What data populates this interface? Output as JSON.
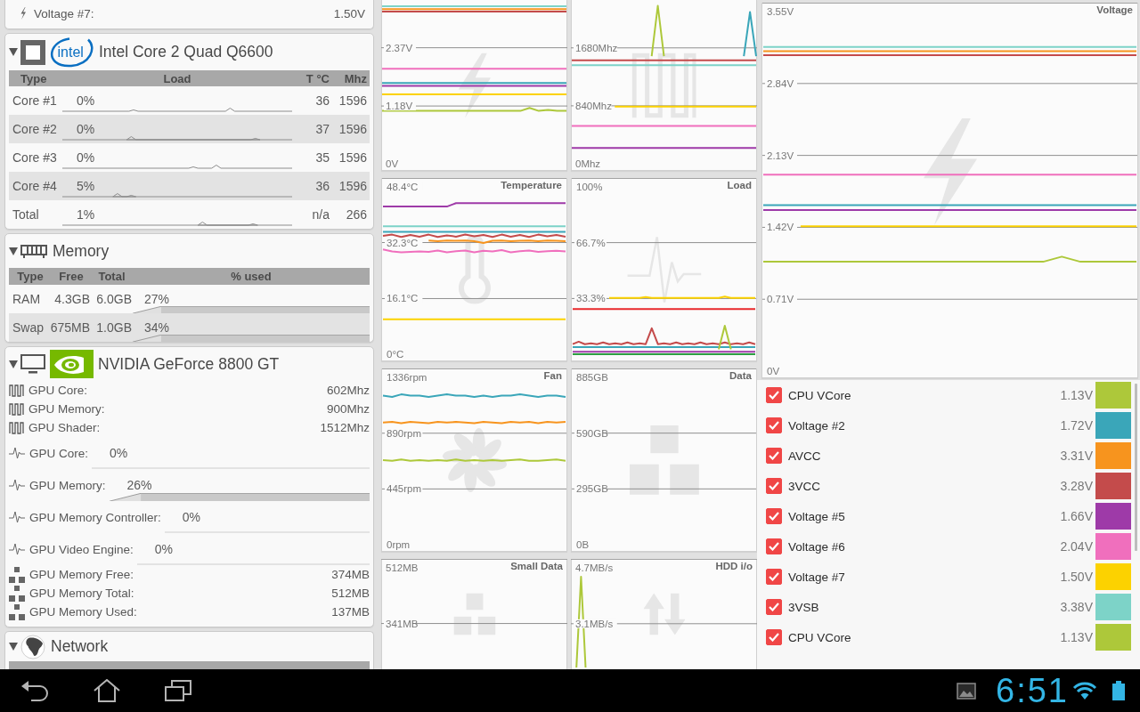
{
  "voltage_panel": {
    "rows": [
      {
        "kind": "voltage",
        "label": "Voltage #7:",
        "value": "1.50V"
      }
    ]
  },
  "cpu": {
    "expanded": true,
    "logo_text": "intel",
    "title": "Intel Core 2 Quad Q6600",
    "columns": [
      "Type",
      "Load",
      "T °C",
      "Mhz"
    ],
    "rows": [
      {
        "name": "Core #1",
        "load": "0%",
        "temperature": "36",
        "clock": "1596"
      },
      {
        "name": "Core #2",
        "load": "0%",
        "temperature": "37",
        "clock": "1596"
      },
      {
        "name": "Core #3",
        "load": "0%",
        "temperature": "35",
        "clock": "1596"
      },
      {
        "name": "Core #4",
        "load": "5%",
        "temperature": "36",
        "clock": "1596"
      },
      {
        "name": "Total",
        "load": "1%",
        "temperature": "n/a",
        "clock": "266"
      }
    ]
  },
  "memory": {
    "expanded": true,
    "title": "Memory",
    "columns": [
      "Type",
      "Free",
      "Total",
      "% used"
    ],
    "rows": [
      {
        "type": "RAM",
        "free": "4.3GB",
        "total": "6.0GB",
        "used": "27%"
      },
      {
        "type": "Swap",
        "free": "675MB",
        "total": "1.0GB",
        "used": "34%"
      }
    ]
  },
  "gpu": {
    "expanded": true,
    "title": "NVIDIA GeForce 8800 GT",
    "rows": [
      {
        "kind": "clock",
        "label": "GPU Core:",
        "value": "602Mhz"
      },
      {
        "kind": "clock",
        "label": "GPU Memory:",
        "value": "900Mhz"
      },
      {
        "kind": "clock",
        "label": "GPU Shader:",
        "value": "1512Mhz"
      },
      {
        "kind": "load",
        "label": "GPU Core:",
        "value": "0%"
      },
      {
        "kind": "load_area",
        "label": "GPU Memory:",
        "value": "26%"
      },
      {
        "kind": "load",
        "label": "GPU Memory Controller:",
        "value": "0%"
      },
      {
        "kind": "load",
        "label": "GPU Video Engine:",
        "value": "0%"
      },
      {
        "kind": "memory",
        "label": "GPU Memory Free:",
        "value": "374MB"
      },
      {
        "kind": "memory",
        "label": "GPU Memory Total:",
        "value": "512MB"
      },
      {
        "kind": "memory",
        "label": "GPU Memory Used:",
        "value": "137MB"
      }
    ]
  },
  "network": {
    "expanded": true,
    "title": "Network"
  },
  "charts": [
    {
      "kind": "voltage",
      "chart_data": {
        "type": "line",
        "grid": true,
        "categories": [
          null,
          null,
          null,
          null,
          null,
          null,
          null,
          null,
          null,
          null,
          null,
          null,
          null,
          null,
          null,
          null,
          null,
          null,
          null,
          null,
          null
        ],
        "ylim": [
          -0.145,
          3.345
        ],
        "yticks": [
          {
            "value": 0,
            "label": "0V"
          },
          {
            "value": 1.18,
            "label": "1.18V"
          },
          {
            "value": 2.37,
            "label": "2.37V"
          }
        ],
        "series": [
          {
            "color": "#7dd3c8",
            "values": [
              3.22,
              3.22,
              3.22,
              3.22,
              3.22,
              3.22,
              3.22,
              3.22,
              3.22,
              3.22,
              3.22,
              3.22,
              3.22,
              3.22,
              3.22,
              3.22,
              3.22,
              3.22,
              3.22,
              3.22,
              3.22
            ]
          },
          {
            "color": "#f7941e",
            "values": [
              3.16,
              3.16,
              3.16,
              3.16,
              3.16,
              3.16,
              3.16,
              3.16,
              3.16,
              3.16,
              3.16,
              3.16,
              3.16,
              3.16,
              3.16,
              3.16,
              3.16,
              3.16,
              3.16,
              3.16,
              3.16
            ]
          },
          {
            "color": "#c44b4b",
            "values": [
              3.11,
              3.11,
              3.11,
              3.11,
              3.11,
              3.11,
              3.11,
              3.11,
              3.11,
              3.11,
              3.11,
              3.11,
              3.11,
              3.11,
              3.11,
              3.11,
              3.11,
              3.11,
              3.11,
              3.11,
              3.11
            ]
          },
          {
            "color": "#f06fbd",
            "values": [
              1.94,
              1.94,
              1.94,
              1.94,
              1.94,
              1.94,
              1.94,
              1.94,
              1.94,
              1.94,
              1.94,
              1.94,
              1.94,
              1.94,
              1.94,
              1.94,
              1.94,
              1.94,
              1.94,
              1.94,
              1.94
            ]
          },
          {
            "color": "#3aa6b9",
            "values": [
              1.65,
              1.65,
              1.65,
              1.65,
              1.65,
              1.65,
              1.65,
              1.65,
              1.65,
              1.65,
              1.65,
              1.65,
              1.65,
              1.65,
              1.65,
              1.65,
              1.65,
              1.65,
              1.65,
              1.65,
              1.65
            ]
          },
          {
            "color": "#9e3aa8",
            "values": [
              1.59,
              1.59,
              1.59,
              1.59,
              1.59,
              1.59,
              1.59,
              1.59,
              1.59,
              1.59,
              1.59,
              1.59,
              1.59,
              1.59,
              1.59,
              1.59,
              1.59,
              1.59,
              1.59,
              1.59,
              1.59
            ]
          },
          {
            "color": "#fcd200",
            "values": [
              1.42,
              1.42,
              1.42,
              1.42,
              1.42,
              1.42,
              1.42,
              1.42,
              1.42,
              1.42,
              1.42,
              1.42,
              1.42,
              1.42,
              1.42,
              1.42,
              1.42,
              1.42,
              1.42,
              1.42,
              1.42
            ]
          },
          {
            "color": "#adc83a",
            "values": [
              1.08,
              1.08,
              1.08,
              1.08,
              1.08,
              1.08,
              1.08,
              1.08,
              1.08,
              1.08,
              1.08,
              1.08,
              1.08,
              1.08,
              1.08,
              1.08,
              1.14,
              1.08,
              1.1,
              1.08,
              1.08
            ]
          }
        ]
      }
    },
    {
      "kind": "clock",
      "chart_data": {
        "type": "line",
        "grid": true,
        "categories": [
          null,
          null,
          null,
          null,
          null,
          null,
          null,
          null,
          null,
          null,
          null,
          null,
          null,
          null,
          null,
          null,
          null,
          null,
          null,
          null,
          null,
          null,
          null,
          null,
          null,
          null,
          null,
          null,
          null,
          null,
          null
        ],
        "ylim": [
          -103,
          2374
        ],
        "yticks": [
          {
            "value": 0,
            "label": "0Mhz"
          },
          {
            "value": 840,
            "label": "840Mhz"
          },
          {
            "value": 1680,
            "label": "1680Mhz"
          }
        ],
        "series": [
          {
            "color": "#7dd3c8",
            "values": [
              1430,
              1430,
              1430,
              1430,
              1430,
              1430,
              1430,
              1430,
              1430,
              1430,
              1430,
              1430,
              1430,
              1430,
              1430,
              1430,
              1430,
              1430,
              1430,
              1430,
              1430,
              1430,
              1430,
              1430,
              1430,
              1430,
              1430,
              1430,
              1430,
              1430,
              1430
            ]
          },
          {
            "color": "#c44b4b",
            "values": [
              1500,
              1500,
              1500,
              1500,
              1500,
              1500,
              1500,
              1500,
              1500,
              1500,
              1500,
              1500,
              1500,
              1500,
              1500,
              1500,
              1500,
              1500,
              1500,
              1500,
              1500,
              1500,
              1500,
              1500,
              1500,
              1500,
              1500,
              1500,
              1500,
              1500,
              1500
            ]
          },
          {
            "color": "#adc83a",
            "values": [
              null,
              null,
              null,
              null,
              null,
              null,
              null,
              null,
              null,
              null,
              null,
              null,
              null,
              1560,
              2290,
              1560,
              null,
              null,
              null,
              null,
              null,
              null,
              null,
              null,
              null,
              null,
              null,
              null,
              null,
              null,
              null
            ]
          },
          {
            "color": "#3aa6b9",
            "values": [
              null,
              null,
              null,
              null,
              null,
              null,
              null,
              null,
              null,
              null,
              null,
              null,
              null,
              null,
              null,
              null,
              null,
              null,
              null,
              null,
              null,
              null,
              null,
              null,
              null,
              null,
              null,
              null,
              1560,
              2200,
              1560
            ]
          },
          {
            "color": "#fcd200",
            "values": [
              null,
              null,
              null,
              null,
              null,
              null,
              null,
              830,
              830,
              830,
              830,
              830,
              830,
              830,
              830,
              830,
              830,
              830,
              830,
              830,
              830,
              830,
              830,
              830,
              830,
              830,
              830,
              830,
              830,
              830,
              830
            ]
          },
          {
            "color": "#f06fbd",
            "values": [
              550,
              550,
              550,
              550,
              550,
              550,
              550,
              550,
              550,
              550,
              550,
              550,
              550,
              550,
              550,
              550,
              550,
              550,
              550,
              550,
              550,
              550,
              550,
              550,
              550,
              550,
              550,
              550,
              550,
              550,
              550
            ]
          },
          {
            "color": "#9e3aa8",
            "values": [
              230,
              230,
              230,
              230,
              230,
              230,
              230,
              230,
              230,
              230,
              230,
              230,
              230,
              230,
              230,
              230,
              230,
              230,
              230,
              230,
              230,
              230,
              230,
              230,
              230,
              230,
              230,
              230,
              230,
              230,
              230
            ]
          }
        ]
      }
    },
    {
      "kind": "temperature",
      "chart_data": {
        "type": "line",
        "grid": true,
        "title": "Temperature",
        "categories": [
          null,
          null,
          null,
          null,
          null,
          null,
          null,
          null,
          null,
          null,
          null,
          null,
          null,
          null,
          null,
          null,
          null,
          null,
          null,
          null,
          null
        ],
        "ylim": [
          -2.06,
          50.97
        ],
        "yticks": [
          {
            "value": 0,
            "label": "0°C"
          },
          {
            "value": 16.1,
            "label": "16.1°C"
          },
          {
            "value": 32.3,
            "label": "32.3°C"
          },
          {
            "value": 48.4,
            "label": "48.4°C"
          }
        ],
        "series": [
          {
            "color": "#9e3aa8",
            "values": [
              42.7,
              42.7,
              42.7,
              42.7,
              42.7,
              42.7,
              42.7,
              42.7,
              43.7,
              43.7,
              43.7,
              43.7,
              43.7,
              43.7,
              43.7,
              43.7,
              43.7,
              43.7,
              43.7,
              43.7,
              43.7
            ]
          },
          {
            "color": "#7dd3c8",
            "values": [
              37,
              37,
              37,
              37,
              37,
              37,
              37,
              37,
              37,
              37,
              37,
              37,
              37,
              37,
              37,
              37,
              37,
              37,
              37,
              37,
              37
            ]
          },
          {
            "color": "#3aa6b9",
            "values": [
              35.4,
              35.4,
              35.4,
              35.4,
              35.4,
              35.4,
              35.4,
              35.4,
              35.4,
              35.4,
              35.4,
              35.4,
              35.4,
              35.4,
              35.4,
              35.4,
              35.4,
              35.4,
              35.4,
              35.4,
              35.4
            ]
          },
          {
            "color": "#c44b4b",
            "values": [
              34.2,
              34.6,
              33.9,
              34.5,
              34,
              34.6,
              33.9,
              34.4,
              34,
              34.6,
              34.1,
              34.5,
              33.9,
              34.6,
              34,
              34.5,
              33.9,
              34.6,
              34.1,
              34.5,
              34
            ]
          },
          {
            "color": "#f7941e",
            "values": [
              null,
              null,
              null,
              null,
              null,
              32.9,
              32.7,
              32.9,
              32.8,
              32.9,
              32.7,
              32.2,
              32.8,
              32.9,
              32.7,
              32.8,
              32.9,
              32.7,
              32.9,
              32.8,
              32.7
            ]
          },
          {
            "color": "#f06fbd",
            "values": [
              30.3,
              29.7,
              29.5,
              29.6,
              29.7,
              29.6,
              30,
              29.5,
              29.8,
              30,
              29.5,
              29.9,
              29.7,
              30.1,
              29.5,
              29.8,
              30,
              29.6,
              29.8,
              29.9,
              29.7
            ]
          },
          {
            "color": "#fcd200",
            "values": [
              10.1,
              10.1,
              10.1,
              10.1,
              10.1,
              10.1,
              10.1,
              10.1,
              10.1,
              10.1,
              10.1,
              10.1,
              10.1,
              10.1,
              10.1,
              10.1,
              10.1,
              10.1,
              10.1,
              10.1,
              10.1
            ]
          }
        ]
      }
    },
    {
      "kind": "load",
      "chart_data": {
        "type": "line",
        "grid": true,
        "title": "Load",
        "categories": [
          null,
          null,
          null,
          null,
          null,
          null,
          null,
          null,
          null,
          null,
          null,
          null,
          null,
          null,
          null,
          null,
          null,
          null,
          null,
          null,
          null,
          null,
          null,
          null,
          null,
          null,
          null,
          null,
          null,
          null,
          null
        ],
        "ylim": [
          -4.26,
          105.32
        ],
        "yticks": [
          {
            "value": 33.3,
            "label": "33.3%"
          },
          {
            "value": 66.7,
            "label": "66.7%"
          },
          {
            "value": 100,
            "label": "100%"
          }
        ],
        "series": [
          {
            "color": "#fcd200",
            "values": [
              null,
              null,
              null,
              null,
              null,
              null,
              33.6,
              33.6,
              33.6,
              33.6,
              33.6,
              33.6,
              34.2,
              33.6,
              33.6,
              33.6,
              33.6,
              33.6,
              33.6,
              33.6,
              33.6,
              33.6,
              33.6,
              33.6,
              33.6,
              34.4,
              33.6,
              33.6,
              33.6,
              33.6,
              33.6
            ]
          },
          {
            "color": "#e8282b",
            "values": [
              27,
              27,
              27,
              27,
              27,
              27,
              27,
              27,
              27,
              27,
              27,
              27,
              27,
              27,
              27,
              27,
              27,
              27,
              27,
              27,
              27,
              27,
              27,
              27,
              27,
              27,
              27,
              27,
              27,
              27,
              27
            ]
          },
          {
            "color": "#c44b4b",
            "values": [
              6,
              7.5,
              6,
              6.5,
              6,
              7,
              6,
              6.5,
              6,
              7,
              6,
              6.5,
              6,
              15.5,
              6,
              6.5,
              6,
              7,
              6,
              6.5,
              6,
              7,
              6,
              6.5,
              6,
              7,
              6,
              6.5,
              6,
              7,
              6
            ]
          },
          {
            "color": "#3aa6b9",
            "values": [
              4.2,
              4.2,
              4.2,
              4.2,
              4.2,
              4.2,
              4.2,
              4.2,
              4.2,
              4.2,
              4.2,
              4.2,
              4.2,
              4.2,
              4.2,
              4.2,
              4.2,
              4.2,
              4.2,
              4.2,
              4.2,
              4.2,
              4.2,
              4.2,
              4.2,
              4.2,
              4.2,
              4.2,
              4.2,
              4.2,
              4.2
            ]
          },
          {
            "color": "#9e3aa8",
            "values": [
              1.5,
              1.5,
              1.5,
              1.5,
              1.5,
              1.5,
              1.5,
              1.5,
              1.5,
              1.5,
              1.5,
              1.5,
              1.5,
              1.5,
              1.5,
              1.5,
              1.5,
              1.5,
              1.5,
              1.5,
              1.5,
              1.5,
              1.5,
              1.5,
              1.5,
              1.5,
              1.5,
              1.5,
              1.5,
              1.5,
              1.5
            ]
          },
          {
            "color": "#2ea043",
            "values": [
              0,
              0,
              0,
              0,
              0,
              0,
              0,
              0,
              0,
              0,
              0,
              0,
              0,
              0,
              0,
              0,
              0,
              0,
              0,
              0,
              0,
              0,
              0,
              0,
              0,
              0,
              0,
              0,
              0,
              0,
              0
            ]
          },
          {
            "color": "#adc83a",
            "values": [
              null,
              null,
              null,
              null,
              null,
              null,
              null,
              null,
              null,
              null,
              null,
              null,
              null,
              null,
              null,
              null,
              null,
              null,
              null,
              null,
              null,
              null,
              null,
              null,
              2.9,
              17,
              2.9,
              null,
              null,
              null,
              null
            ]
          }
        ]
      }
    },
    {
      "kind": "fan",
      "chart_data": {
        "type": "line",
        "grid": true,
        "title": "Fan",
        "categories": [
          null,
          null,
          null,
          null,
          null,
          null,
          null,
          null,
          null,
          null,
          null,
          null,
          null,
          null,
          null,
          null,
          null,
          null,
          null,
          null,
          null
        ],
        "ylim": [
          -56.9,
          1407.1
        ],
        "yticks": [
          {
            "value": 0,
            "label": "0rpm"
          },
          {
            "value": 445,
            "label": "445rpm"
          },
          {
            "value": 890,
            "label": "890rpm"
          },
          {
            "value": 1336,
            "label": "1336rpm"
          }
        ],
        "series": [
          {
            "color": "#3aa6b9",
            "values": [
              1190,
              1180,
              1200,
              1190,
              1190,
              1180,
              1190,
              1200,
              1190,
              1190,
              1180,
              1190,
              1180,
              1190,
              1190,
              1200,
              1190,
              1180,
              1190,
              1190,
              1180
            ]
          },
          {
            "color": "#f7941e",
            "values": [
              975,
              980,
              970,
              980,
              975,
              970,
              980,
              975,
              980,
              975,
              970,
              980,
              975,
              970,
              980,
              975,
              980,
              970,
              980,
              975,
              980
            ]
          },
          {
            "color": "#adc83a",
            "values": [
              675,
              670,
              680,
              670,
              675,
              670,
              675,
              670,
              680,
              670,
              675,
              670,
              675,
              670,
              675,
              680,
              670,
              670,
              675,
              680,
              670
            ]
          }
        ]
      }
    },
    {
      "kind": "data",
      "chart_data": {
        "type": "line",
        "grid": true,
        "title": "Data",
        "categories": [
          null,
          null,
          null,
          null,
          null,
          null,
          null,
          null,
          null,
          null,
          null,
          null,
          null,
          null,
          null,
          null,
          null,
          null,
          null,
          null,
          null
        ],
        "ylim": [
          -37.7,
          932.1
        ],
        "yticks": [
          {
            "value": 0,
            "label": "0B"
          },
          {
            "value": 295,
            "label": "295GB"
          },
          {
            "value": 590,
            "label": "590GB"
          },
          {
            "value": 885,
            "label": "885GB"
          }
        ]
      }
    },
    {
      "kind": "small_data",
      "chart_data": {
        "type": "line",
        "grid": true,
        "title": "Small Data",
        "categories": [
          null,
          null,
          null,
          null,
          null,
          null,
          null,
          null,
          null,
          null,
          null,
          null,
          null,
          null,
          null,
          null,
          null,
          null,
          null,
          null,
          null
        ],
        "ylim": [
          201,
          539.3
        ],
        "yticks": [
          {
            "value": 341.3,
            "label": "341MB"
          },
          {
            "value": 512,
            "label": "512MB"
          }
        ]
      }
    },
    {
      "kind": "io",
      "chart_data": {
        "type": "line",
        "grid": true,
        "title": "HDD i/o",
        "categories": [
          null,
          null,
          null,
          null,
          null,
          null,
          null,
          null,
          null,
          null,
          null,
          null,
          null,
          null,
          null,
          null,
          null,
          null,
          null,
          null,
          null,
          null,
          null,
          null,
          null,
          null,
          null,
          null,
          null,
          null,
          null,
          null,
          null,
          null,
          null,
          null,
          null,
          null,
          null,
          null,
          null
        ],
        "ylim": [
          1.85,
          4.95
        ],
        "yticks": [
          {
            "value": 3.13,
            "label": "3.1MB/s"
          },
          {
            "value": 4.7,
            "label": "4.7MB/s"
          }
        ],
        "series": [
          {
            "color": "#adc83a",
            "values": [
              null,
              1.9,
              4.45,
              1.9,
              null,
              null,
              null,
              null,
              null,
              null,
              null,
              null,
              null,
              null,
              null,
              null,
              null,
              null,
              null,
              null,
              null,
              null,
              null,
              null,
              null,
              null,
              null,
              null,
              null,
              null,
              null,
              null,
              null,
              null,
              null,
              null,
              null,
              null,
              null,
              null,
              null
            ]
          }
        ]
      }
    }
  ],
  "voltage_chart": {
    "kind": "voltage",
    "chart_data": {
      "type": "line",
      "grid": true,
      "title": "Voltage",
      "categories": [
        null,
        null,
        null,
        null,
        null,
        null,
        null,
        null,
        null,
        null,
        null,
        null,
        null,
        null,
        null,
        null,
        null,
        null,
        null,
        null,
        null
      ],
      "ylim": [
        -0.07,
        3.638
      ],
      "yticks": [
        {
          "value": 0,
          "label": "0V"
        },
        {
          "value": 0.71,
          "label": "0.71V"
        },
        {
          "value": 1.42,
          "label": "1.42V"
        },
        {
          "value": 2.13,
          "label": "2.13V"
        },
        {
          "value": 2.84,
          "label": "2.84V"
        },
        {
          "value": 3.55,
          "label": "3.55V"
        }
      ],
      "series": [
        {
          "color": "#7dd3c8",
          "values": [
            3.2,
            3.2,
            3.2,
            3.2,
            3.2,
            3.2,
            3.2,
            3.2,
            3.2,
            3.2,
            3.2,
            3.2,
            3.2,
            3.2,
            3.2,
            3.2,
            3.2,
            3.2,
            3.2,
            3.2,
            3.2
          ]
        },
        {
          "color": "#f7941e",
          "values": [
            3.16,
            3.16,
            3.16,
            3.16,
            3.16,
            3.16,
            3.16,
            3.16,
            3.16,
            3.16,
            3.16,
            3.16,
            3.16,
            3.16,
            3.16,
            3.16,
            3.16,
            3.16,
            3.16,
            3.16,
            3.16
          ]
        },
        {
          "color": "#c44b4b",
          "values": [
            3.12,
            3.12,
            3.12,
            3.12,
            3.12,
            3.12,
            3.12,
            3.12,
            3.12,
            3.12,
            3.12,
            3.12,
            3.12,
            3.12,
            3.12,
            3.12,
            3.12,
            3.12,
            3.12,
            3.12,
            3.12
          ]
        },
        {
          "color": "#f06fbd",
          "values": [
            1.94,
            1.94,
            1.94,
            1.94,
            1.94,
            1.94,
            1.94,
            1.94,
            1.94,
            1.94,
            1.94,
            1.94,
            1.94,
            1.94,
            1.94,
            1.94,
            1.94,
            1.94,
            1.94,
            1.94,
            1.94
          ]
        },
        {
          "color": "#3aa6b9",
          "values": [
            1.64,
            1.64,
            1.64,
            1.64,
            1.64,
            1.64,
            1.64,
            1.64,
            1.64,
            1.64,
            1.64,
            1.64,
            1.64,
            1.64,
            1.64,
            1.64,
            1.64,
            1.64,
            1.64,
            1.64,
            1.64
          ]
        },
        {
          "color": "#9e3aa8",
          "values": [
            1.59,
            1.59,
            1.59,
            1.59,
            1.59,
            1.59,
            1.59,
            1.59,
            1.59,
            1.59,
            1.59,
            1.59,
            1.59,
            1.59,
            1.59,
            1.59,
            1.59,
            1.59,
            1.59,
            1.59,
            1.59
          ]
        },
        {
          "color": "#fcd200",
          "values": [
            null,
            null,
            1.43,
            1.43,
            1.43,
            1.43,
            1.43,
            1.43,
            1.43,
            1.43,
            1.43,
            1.43,
            1.43,
            1.43,
            1.43,
            1.43,
            1.43,
            1.43,
            1.43,
            1.43,
            1.43
          ]
        },
        {
          "color": "#adc83a",
          "values": [
            1.08,
            1.08,
            1.08,
            1.08,
            1.08,
            1.08,
            1.08,
            1.08,
            1.08,
            1.08,
            1.08,
            1.08,
            1.08,
            1.08,
            1.08,
            1.08,
            1.13,
            1.08,
            1.08,
            1.08,
            1.08
          ]
        }
      ]
    }
  },
  "voltage_legend": [
    {
      "label": "CPU VCore",
      "value": "1.13V",
      "color": "#adc83a",
      "checked": true
    },
    {
      "label": "Voltage #2",
      "value": "1.72V",
      "color": "#3aa6b9",
      "checked": true
    },
    {
      "label": "AVCC",
      "value": "3.31V",
      "color": "#f7941e",
      "checked": true
    },
    {
      "label": "3VCC",
      "value": "3.28V",
      "color": "#c44b4b",
      "checked": true
    },
    {
      "label": "Voltage #5",
      "value": "1.66V",
      "color": "#9e3aa8",
      "checked": true
    },
    {
      "label": "Voltage #6",
      "value": "2.04V",
      "color": "#f06fbd",
      "checked": true
    },
    {
      "label": "Voltage #7",
      "value": "1.50V",
      "color": "#fcd200",
      "checked": true
    },
    {
      "label": "3VSB",
      "value": "3.38V",
      "color": "#7dd3c8",
      "checked": true
    },
    {
      "label": "CPU VCore",
      "value": "1.13V",
      "color": "#adc83a",
      "checked": true
    }
  ],
  "navigation_bar": {
    "time": "6:51"
  }
}
